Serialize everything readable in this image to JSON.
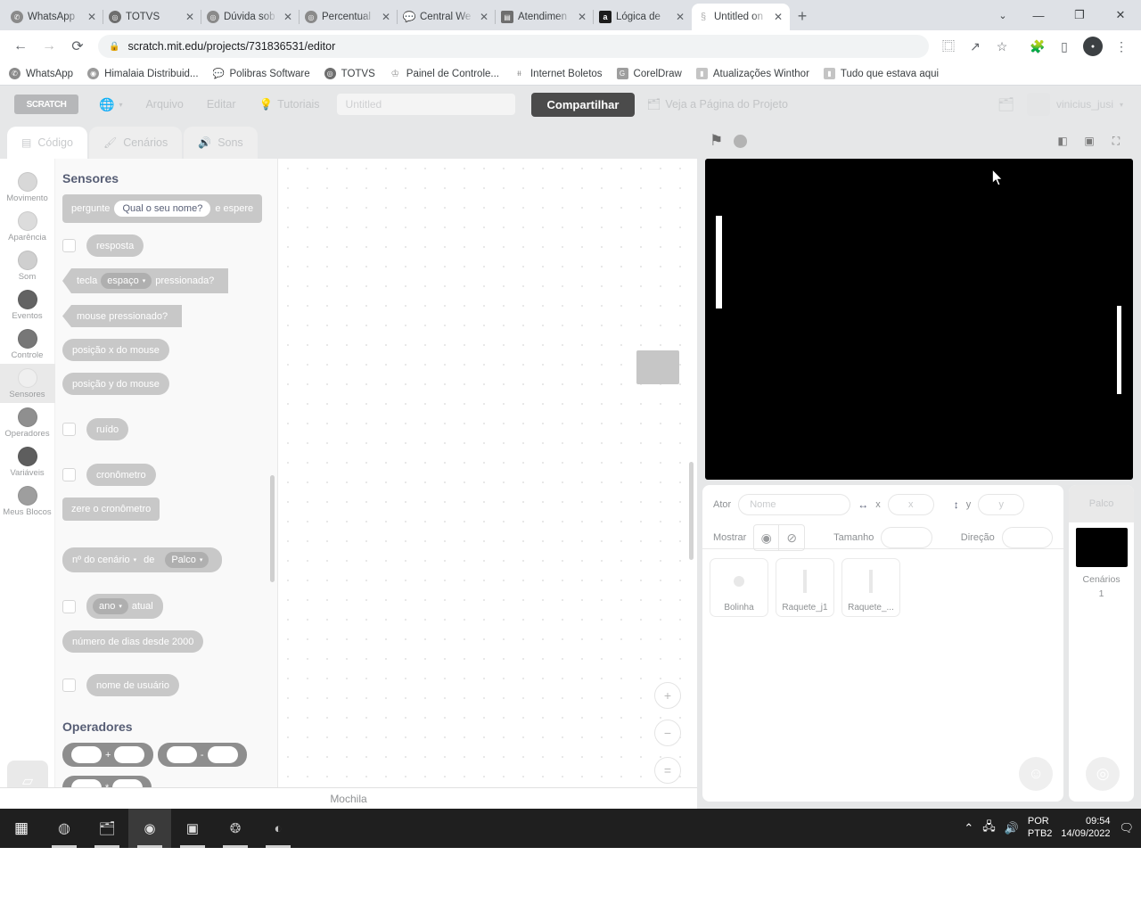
{
  "browser": {
    "tabs": [
      {
        "label": "WhatsApp",
        "favicon": "whatsapp-icon",
        "color": "#25d366",
        "glyph": "✆",
        "active": false
      },
      {
        "label": "TOTVS",
        "favicon": "totvs-icon",
        "color": "#5b5b5b",
        "glyph": "◎",
        "active": false
      },
      {
        "label": "Dúvida sob",
        "favicon": "generic-icon",
        "color": "#8a8a8a",
        "glyph": "◎",
        "active": false
      },
      {
        "label": "Percentual",
        "favicon": "generic-icon",
        "color": "#8a8a8a",
        "glyph": "◎",
        "active": false
      },
      {
        "label": "Central We",
        "favicon": "chat-icon",
        "color": "#ffffff",
        "glyph": "💬",
        "active": false
      },
      {
        "label": "Atendimen",
        "favicon": "grid-icon",
        "color": "#6e6e6e",
        "glyph": "▤",
        "active": false
      },
      {
        "label": "Lógica de",
        "favicon": "alura-icon",
        "color": "#1c1c1c",
        "glyph": "a",
        "active": false
      },
      {
        "label": "Untitled on",
        "favicon": "scratch-icon",
        "color": "#bdbdbd",
        "glyph": "§",
        "active": true
      }
    ],
    "new_tab_label": "+",
    "window_controls": {
      "chevron": "⌄",
      "minimize": "—",
      "maximize": "❐",
      "close": "✕"
    },
    "nav": {
      "back": "←",
      "forward": "→",
      "reload": "⟳"
    },
    "omnibox": {
      "lock": "🔒",
      "url": "scratch.mit.edu/projects/731836531/editor"
    },
    "toolbar_icons": [
      "translate-icon",
      "share-icon",
      "bookmark-star-icon",
      "extensions-icon",
      "sidepanel-icon",
      "profile-avatar",
      "menu-kebab-icon"
    ],
    "bookmarks": [
      {
        "label": "WhatsApp",
        "color": "#25d366",
        "glyph": "✆"
      },
      {
        "label": "Himalaia Distribuid...",
        "color": "#9a9a9a",
        "glyph": "◉"
      },
      {
        "label": "Polibras Software",
        "color": "#ffffff",
        "glyph": "💬"
      },
      {
        "label": "TOTVS",
        "color": "#5b5b5b",
        "glyph": "◎"
      },
      {
        "label": "Painel de Controle...",
        "color": "#9a9a9a",
        "glyph": "♔"
      },
      {
        "label": "Internet Boletos",
        "color": "#ffffff",
        "glyph": "ᵻᵼ"
      },
      {
        "label": "CorelDraw",
        "color": "#8f8f8f",
        "glyph": "G"
      },
      {
        "label": "Atualizações Winthor",
        "color": "#b9b9b9",
        "glyph": "▮"
      },
      {
        "label": "Tudo que estava aqui",
        "color": "#b9b9b9",
        "glyph": "▮"
      }
    ]
  },
  "scratch": {
    "logo_text": "SCRATCH",
    "menu": {
      "globe_icon": "globe-icon",
      "arquivo": "Arquivo",
      "editar": "Editar",
      "tutoriais": "Tutoriais",
      "tutorial_icon": "lightbulb-icon",
      "project_title": "Untitled",
      "share": "Compartilhar",
      "project_page": "Veja a Página do Projeto",
      "project_page_icon": "folder-icon"
    },
    "account": {
      "username": "vinicius_jusi",
      "chevron": "▾",
      "folder_icon": "folder-icon"
    },
    "tabs": [
      {
        "label": "Código",
        "icon": "code-icon",
        "active": true
      },
      {
        "label": "Cenários",
        "icon": "paintbrush-icon",
        "active": false
      },
      {
        "label": "Sons",
        "icon": "sound-icon",
        "active": false
      }
    ],
    "categories": [
      {
        "label": "Movimento",
        "color": "#d8d8d8"
      },
      {
        "label": "Aparência",
        "color": "#dcdcdc"
      },
      {
        "label": "Som",
        "color": "#cfcfcf"
      },
      {
        "label": "Eventos",
        "color": "#636363"
      },
      {
        "label": "Controle",
        "color": "#777777"
      },
      {
        "label": "Sensores",
        "color": "#e7e7e7",
        "selected": true
      },
      {
        "label": "Operadores",
        "color": "#8f8f8f"
      },
      {
        "label": "Variáveis",
        "color": "#5e5e5e"
      },
      {
        "label": "Meus Blocos",
        "color": "#9e9e9e"
      }
    ],
    "add_extension_icon": "add-extension-icon",
    "palette": {
      "section_sensores": "Sensores",
      "section_operadores": "Operadores",
      "blocks": {
        "pergunte_pre": "pergunte",
        "pergunte_value": "Qual o seu nome?",
        "pergunte_post": "e espere",
        "resposta": "resposta",
        "tecla_pre": "tecla",
        "tecla_key": "espaço",
        "tecla_post": "pressionada?",
        "mouse_pressionado": "mouse pressionado?",
        "posicao_x": "posição x do mouse",
        "posicao_y": "posição y do mouse",
        "ruido": "ruído",
        "cronometro": "cronômetro",
        "zere_cronometro": "zere o cronômetro",
        "cenario_pre": "nº do cenário",
        "cenario_mid": "de",
        "cenario_target": "Palco",
        "ano_field": "ano",
        "ano_post": "atual",
        "dias_desde_2000": "número de dias desde 2000",
        "nome_usuario": "nome de usuário",
        "op_add": "+",
        "op_sub": "-",
        "op_mul": "*"
      }
    },
    "workspace": {
      "zoom_in": "+",
      "zoom_out": "−",
      "zoom_reset": "=",
      "backpack_label": "Mochila"
    },
    "stage": {
      "green_flag_icon": "green-flag-icon",
      "stop_icon": "stop-icon",
      "layout_small_icon": "small-stage-icon",
      "layout_large_icon": "large-stage-icon",
      "layout_fullscreen_icon": "fullscreen-icon",
      "backdrop_color": "#000000",
      "objects": [
        {
          "name": "paddle-left",
          "color": "#ffffff"
        },
        {
          "name": "paddle-right",
          "color": "#ffffff"
        },
        {
          "name": "ball",
          "color": "#ffffff"
        }
      ]
    },
    "sprite_info": {
      "ator_label": "Ator",
      "name_placeholder": "Nome",
      "name_value": "",
      "x_label": "x",
      "x_value": "x",
      "y_label": "y",
      "y_value": "y",
      "mostrar_label": "Mostrar",
      "show_icon": "eye-icon",
      "hide_icon": "eye-slash-icon",
      "tamanho_label": "Tamanho",
      "tamanho_value": "",
      "direcao_label": "Direção",
      "direcao_value": "",
      "x_arrow_icon": "horizontal-arrow-icon",
      "y_arrow_icon": "vertical-arrow-icon"
    },
    "sprites": [
      {
        "name": "Bolinha",
        "thumb": "dot"
      },
      {
        "name": "Raquete_j1",
        "thumb": "bar"
      },
      {
        "name": "Raquete_...",
        "thumb": "bar"
      }
    ],
    "add_sprite_icon": "add-sprite-icon",
    "stage_panel": {
      "title": "Palco",
      "backdrops_label": "Cenários",
      "backdrops_count": "1",
      "add_backdrop_icon": "add-backdrop-icon"
    }
  },
  "taskbar": {
    "items": [
      {
        "name": "start-button",
        "glyph": "▦",
        "color": "#ffffff",
        "bg": "transparent",
        "running": false,
        "active": false
      },
      {
        "name": "cortana-icon",
        "glyph": "◍",
        "color": "#c9c9c9",
        "bg": "transparent",
        "running": false,
        "active": false
      },
      {
        "name": "file-explorer-icon",
        "glyph": "🗂",
        "color": "#d9d9d9",
        "bg": "transparent",
        "running": true,
        "active": false
      },
      {
        "name": "chrome-icon",
        "glyph": "◉",
        "color": "#e4e4e4",
        "bg": "#3a3a3a",
        "running": true,
        "active": true
      },
      {
        "name": "office-icon",
        "glyph": "▣",
        "color": "#e0e0e0",
        "bg": "transparent",
        "running": true,
        "active": false
      },
      {
        "name": "app-icon",
        "glyph": "❂",
        "color": "#bdbdbd",
        "bg": "transparent",
        "running": true,
        "active": false
      },
      {
        "name": "media-icon",
        "glyph": "◐",
        "color": "#c0c0c0",
        "bg": "transparent",
        "running": true,
        "active": false
      }
    ],
    "tray": {
      "chevron": "⌃",
      "network_icon": "network-icon",
      "volume_icon": "volume-icon",
      "lang_line1": "POR",
      "lang_line2": "PTB2",
      "time": "09:54",
      "date": "14/09/2022",
      "notification_icon": "notification-icon"
    }
  }
}
